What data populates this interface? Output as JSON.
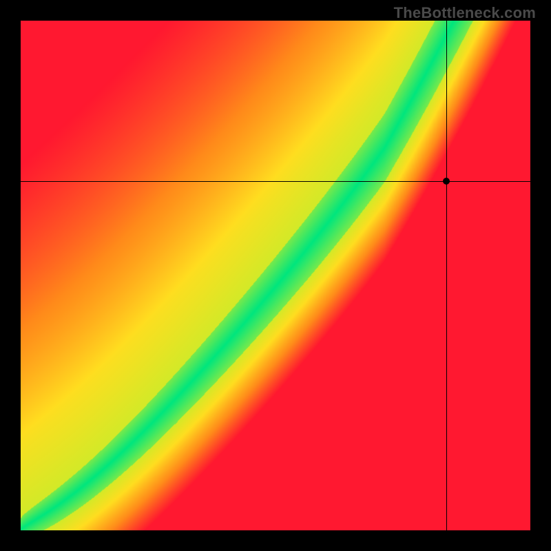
{
  "watermark": "TheBottleneck.com",
  "chart_data": {
    "type": "heatmap",
    "title": "",
    "xlabel": "",
    "ylabel": "",
    "xlim": [
      0,
      1
    ],
    "ylim": [
      0,
      1
    ],
    "grid": false,
    "legend": false,
    "colormap_note": "green = optimal, yellow = near-optimal, red = bottleneck",
    "optimal_curve_note": "narrow green band along a monotone curve roughly y = f(x); region above (toward top-right triangle) skews yellow-orange, region below (bottom-left) skews red",
    "crosshair": {
      "x": 0.835,
      "y": 0.685
    },
    "point": {
      "x": 0.835,
      "y": 0.685
    },
    "colors": {
      "red": "#ff1830",
      "orange": "#ff8b1a",
      "yellow": "#ffde20",
      "yellowgreen": "#c8ed2a",
      "green": "#00e67e"
    }
  }
}
